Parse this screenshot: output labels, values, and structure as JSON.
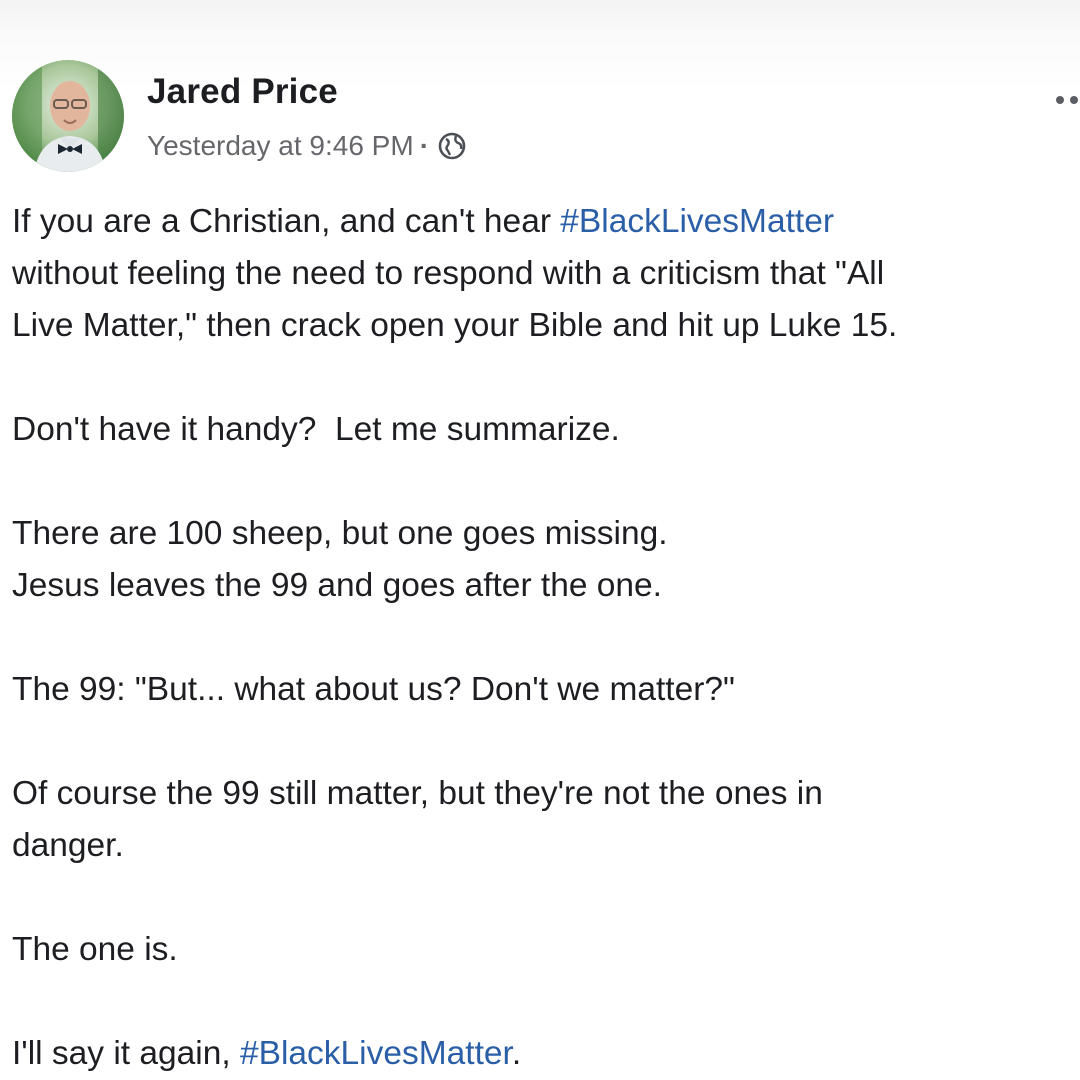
{
  "post": {
    "author": "Jared Price",
    "timestamp": "Yesterday at 9:46 PM",
    "separator": "·",
    "audience_icon": "globe-icon",
    "menu_icon": "more-options-icon",
    "body": {
      "line1_prefix": "If you are a Christian, and can't hear ",
      "hashtag1": "#BlackLivesMatter",
      "line2": "without feeling the need to respond with a criticism that \"All",
      "line3": "Live Matter,\" then crack open your Bible and hit up Luke 15.",
      "para2": "Don't have it handy?  Let me summarize.",
      "para3_line1": "There are 100 sheep, but one goes missing.",
      "para3_line2": "Jesus leaves the 99 and goes after the one.",
      "para4": "The 99: \"But... what about us? Don't we matter?\"",
      "para5_line1": "Of course the 99 still matter, but they're not the ones in",
      "para5_line2": "danger.",
      "para6": "The one is.",
      "para7_prefix": "I'll say it again, ",
      "hashtag2": "#BlackLivesMatter",
      "para7_suffix": "."
    }
  },
  "colors": {
    "text": "#1c1e21",
    "meta": "#65676b",
    "hashtag": "#2a5fa8",
    "background": "#ffffff"
  }
}
